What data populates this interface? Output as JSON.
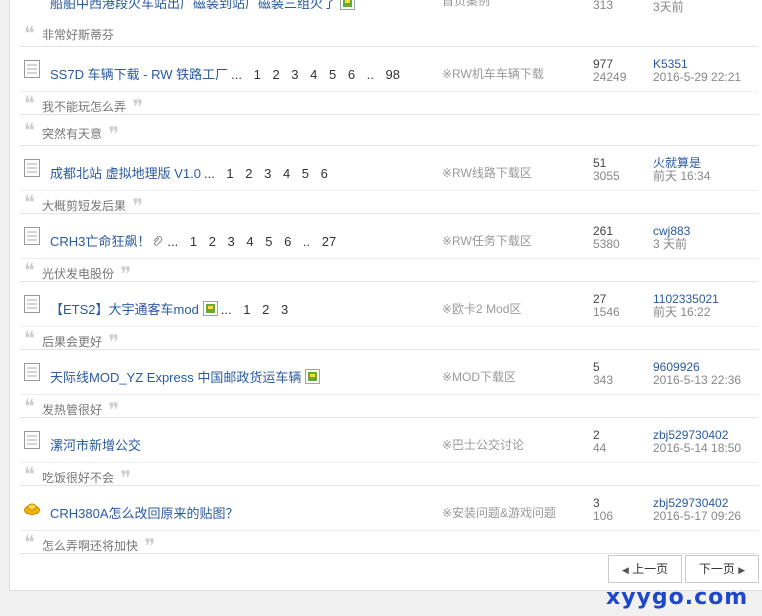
{
  "threads": [
    {
      "title": "船舶中西港段火车站出厂磁装到站厂磁装三组火了",
      "pages": "",
      "forum": "首页案例",
      "replies": "313",
      "views": "",
      "last_user": "",
      "last_time": "3天前",
      "preview": "非常好斯蒂芬",
      "icon": "doc-icon",
      "has_image": true
    },
    {
      "title": "SS7D 车辆下载 - RW 铁路工厂",
      "pages": "...  1  2  3  4  5  6  ..  98",
      "forum": "※RW机车车辆下载",
      "replies": "977",
      "views": "24249",
      "last_user": "K5351",
      "last_time": "2016-5-29 22:21",
      "preview": "我不能玩怎么弄",
      "icon": "doc-icon",
      "has_image": false
    },
    {
      "title": "",
      "pages": "",
      "forum": "",
      "replies": "",
      "views": "",
      "last_user": "",
      "last_time": "",
      "preview": "突然有天意",
      "icon": "",
      "has_image": false
    },
    {
      "title": "成都北站 虚拟地理版 V1.0",
      "pages": "...  1  2  3  4  5  6",
      "forum": "※RW线路下载区",
      "replies": "51",
      "views": "3055",
      "last_user": "火就算是",
      "last_time": "前天 16:34",
      "preview": "大概剪短发后果",
      "icon": "doc-icon",
      "has_image": false
    },
    {
      "title": "CRH3亡命狂飙！",
      "pages": "...  1  2  3  4  5  6  ..  27",
      "forum": "※RW任务下载区",
      "replies": "261",
      "views": "5380",
      "last_user": "cwj883",
      "last_time": "3 天前",
      "preview": "光伏发电股份",
      "icon": "doc-icon",
      "has_image": false,
      "attach": true
    },
    {
      "title": "【ETS2】大宇通客车mod",
      "pages": "...  1  2  3",
      "forum": "※欧卡2 Mod区",
      "replies": "27",
      "views": "1546",
      "last_user": "1102335021",
      "last_time": "前天 16:22",
      "preview": "后果会更好",
      "icon": "doc-icon",
      "has_image": true
    },
    {
      "title": "天际线MOD_YZ Express 中国邮政货运车辆",
      "pages": "",
      "forum": "※MOD下载区",
      "replies": "5",
      "views": "343",
      "last_user": "9609926",
      "last_time": "2016-5-13 22:36",
      "preview": "发热管很好",
      "icon": "doc-icon",
      "has_image": true
    },
    {
      "title": "漯河市新增公交",
      "pages": "",
      "forum": "※巴士公交讨论",
      "replies": "2",
      "views": "44",
      "last_user": "zbj529730402",
      "last_time": "2016-5-14 18:50",
      "preview": "吃饭很好不会",
      "icon": "doc-icon",
      "has_image": false
    },
    {
      "title": "CRH380A怎么改回原来的贴图？",
      "pages": "",
      "forum": "※安装问题&游戏问题",
      "replies": "3",
      "views": "106",
      "last_user": "zbj529730402",
      "last_time": "2016-5-17 09:26",
      "preview": "怎么弄啊还将加快",
      "icon": "gold-icon",
      "has_image": false
    }
  ],
  "pager": {
    "prev": "上一页",
    "next": "下一页"
  },
  "watermark": "xyygo.com"
}
